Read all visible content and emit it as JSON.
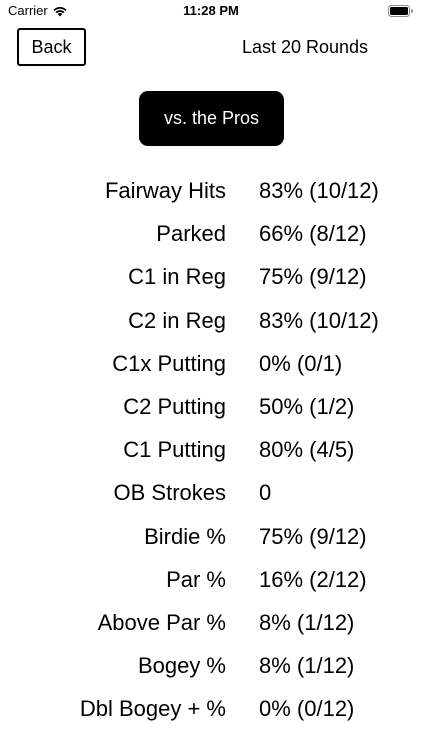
{
  "status_bar": {
    "carrier": "Carrier",
    "time": "11:28 PM"
  },
  "nav": {
    "back_label": "Back",
    "title": "Last 20 Rounds"
  },
  "pros_button_label": "vs. the Pros",
  "stats": [
    {
      "label": "Fairway Hits",
      "value": "83% (10/12)"
    },
    {
      "label": "Parked",
      "value": "66% (8/12)"
    },
    {
      "label": "C1 in Reg",
      "value": "75% (9/12)"
    },
    {
      "label": "C2 in Reg",
      "value": "83% (10/12)"
    },
    {
      "label": "C1x Putting",
      "value": "0% (0/1)"
    },
    {
      "label": "C2 Putting",
      "value": "50% (1/2)"
    },
    {
      "label": "C1 Putting",
      "value": "80% (4/5)"
    },
    {
      "label": "OB Strokes",
      "value": "0"
    },
    {
      "label": "Birdie %",
      "value": "75% (9/12)"
    },
    {
      "label": "Par %",
      "value": "16% (2/12)"
    },
    {
      "label": "Above Par %",
      "value": "8% (1/12)"
    },
    {
      "label": "Bogey %",
      "value": "8% (1/12)"
    },
    {
      "label": "Dbl Bogey + %",
      "value": "0% (0/12)"
    }
  ]
}
